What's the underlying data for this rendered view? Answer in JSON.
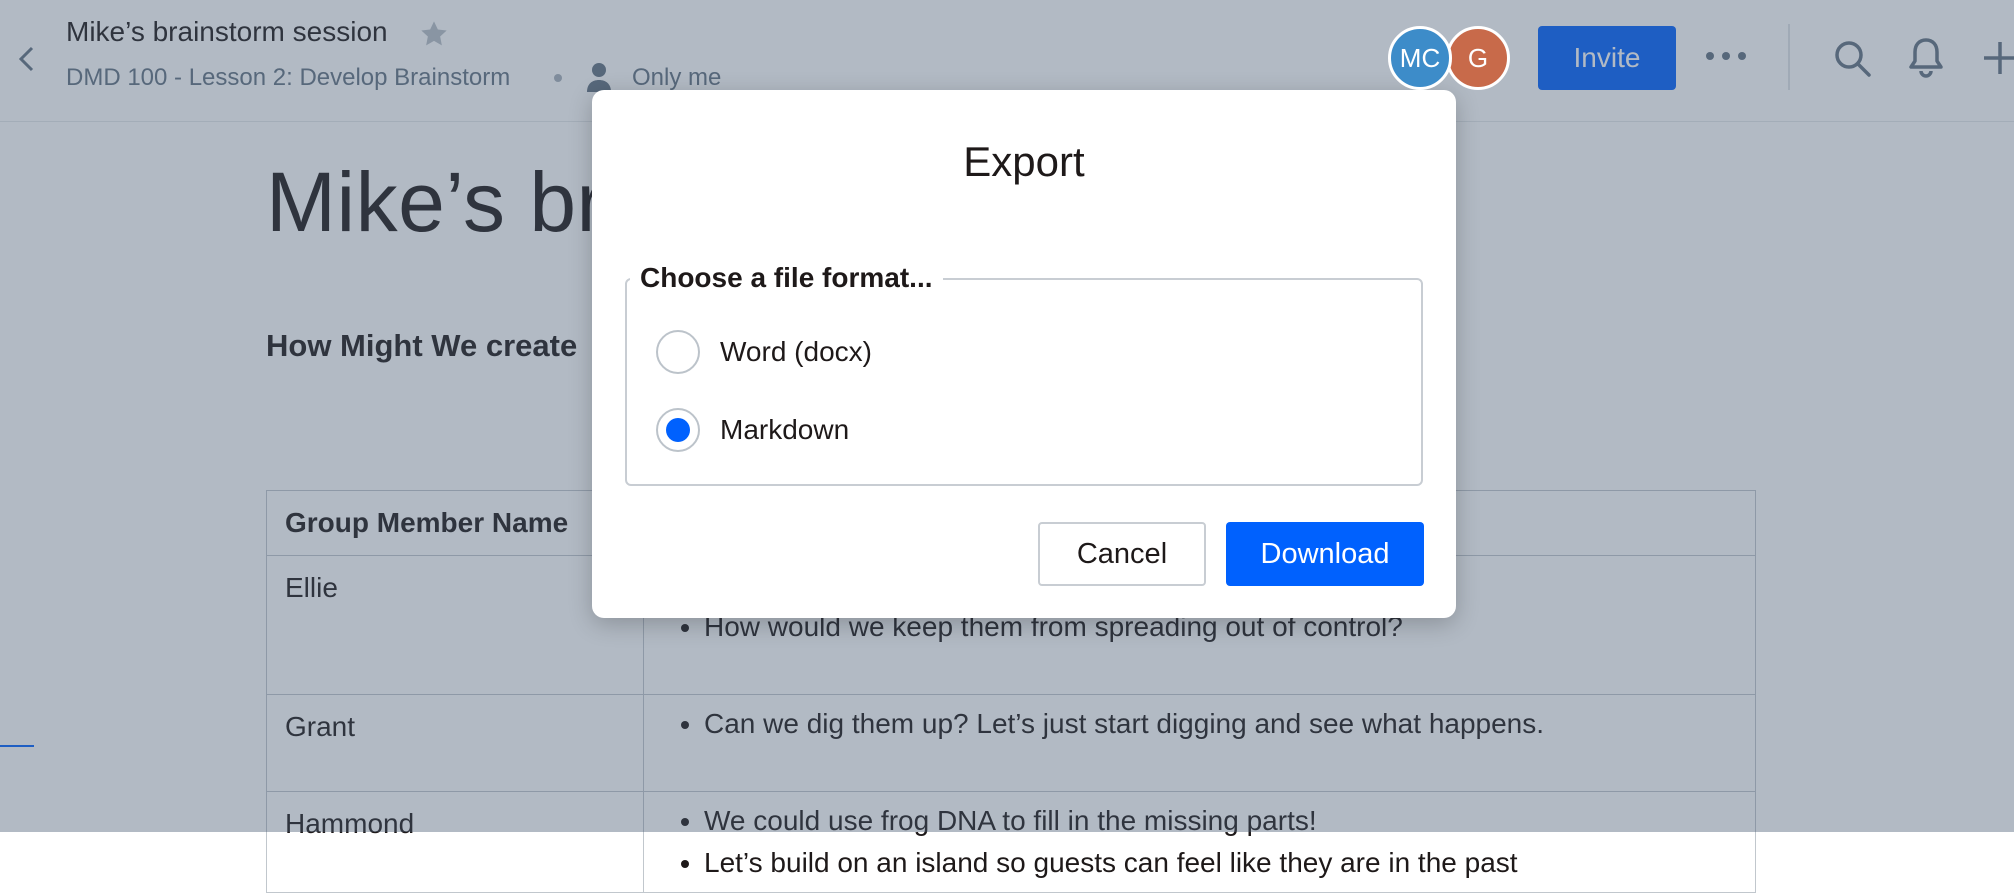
{
  "header": {
    "title": "Mike’s brainstorm session",
    "folder": "DMD 100 - Lesson 2: Develop Brainstorm",
    "visibility": "Only me",
    "avatars": [
      {
        "initials": "MC",
        "color": "#3d8cc9"
      },
      {
        "initials": "G",
        "color": "#c86a4a"
      }
    ],
    "invite_label": "Invite"
  },
  "document": {
    "heading_visible": "Mike’s br",
    "subheading_visible": "How Might We create",
    "table": {
      "header_name": "Group Member Name",
      "rows": [
        {
          "name": "Ellie",
          "items": [
            "How would we keep them from spreading out of control?"
          ]
        },
        {
          "name": "Grant",
          "items": [
            "Can we dig them up? Let’s just start digging and see what happens."
          ]
        },
        {
          "name": "Hammond",
          "items": [
            "We could use frog DNA to fill in the missing parts!",
            "Let’s build on an island so guests can feel like they are in the past"
          ]
        }
      ]
    }
  },
  "modal": {
    "title": "Export",
    "legend": "Choose a file format...",
    "options": [
      {
        "label": "Word (docx)",
        "selected": false
      },
      {
        "label": "Markdown",
        "selected": true
      }
    ],
    "cancel_label": "Cancel",
    "download_label": "Download"
  },
  "colors": {
    "accent": "#0061fe",
    "overlay": "#485a73"
  }
}
